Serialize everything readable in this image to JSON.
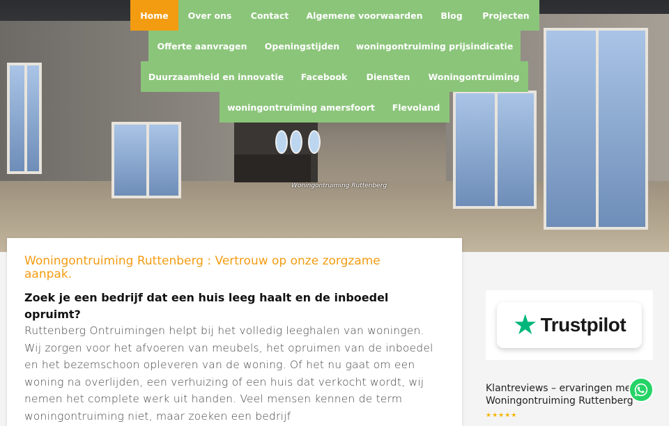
{
  "nav": {
    "items": [
      {
        "label": "Home",
        "active": true
      },
      {
        "label": "Over ons"
      },
      {
        "label": "Contact"
      },
      {
        "label": "Algemene voorwaarden"
      },
      {
        "label": "Blog"
      },
      {
        "label": "Projecten"
      },
      {
        "label": "Offerte aanvragen"
      },
      {
        "label": "Openingstijden"
      },
      {
        "label": "woningontruiming prijsindicatie"
      },
      {
        "label": "Duurzaamheid en innovatie"
      },
      {
        "label": "Facebook"
      },
      {
        "label": "Diensten"
      },
      {
        "label": "Woningontruiming"
      },
      {
        "label": "woningontruiming amersfoort"
      },
      {
        "label": "Flevoland"
      }
    ],
    "color": "#8bc57a",
    "active_color": "#f39c12"
  },
  "hero": {
    "caption": "Woningontruiming Ruttenberg"
  },
  "content": {
    "title": "Woningontruiming Ruttenberg : Vertrouw op onze zorgzame aanpak.",
    "subtitle": "Zoek je een bedrijf dat een huis leeg haalt en de inboedel opruimt?",
    "body": "Ruttenberg Ontruimingen helpt bij het volledig leeghalen van woningen. Wij zorgen voor het afvoeren van meubels, het opruimen van de inboedel en het bezemschoon opleveren van de woning. Of het nu gaat om een woning na overlijden, een verhuizing of een huis dat verkocht wordt, wij nemen het complete werk uit handen. Veel mensen kennen de term woningontruiming niet, maar zoeken een bedrijf"
  },
  "sidebar": {
    "trustpilot_label": "Trustpilot",
    "review_title": "Klantreviews – ervaringen met Woningontruiming Ruttenberg",
    "stars": "★★★★★"
  },
  "whatsapp": {
    "icon": "whatsapp-icon",
    "color": "#25d366"
  }
}
